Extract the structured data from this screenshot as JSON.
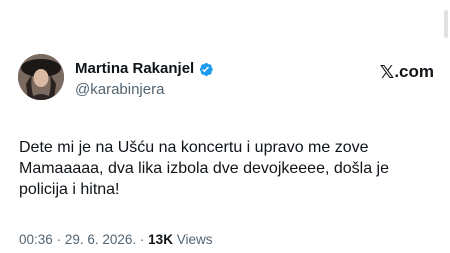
{
  "tweet": {
    "display_name": "Martina Rakanjel",
    "handle": "@karabinjera",
    "verified": true,
    "brand": {
      "glyph": "𝕏",
      "suffix": ".com"
    },
    "text": "Dete mi je na Ušću na koncertu i upravo me zove Mamaaaaa, dva lika izbola dve devojkeeee, došla je policija i hitna!",
    "time": "00:36",
    "separator": "·",
    "date": "29. 6. 2026.",
    "views_count": "13K",
    "views_label": "Views"
  },
  "colors": {
    "text": "#0f1419",
    "secondary": "#536471",
    "verified_blue": "#1d9bf0",
    "background": "#ffffff"
  },
  "icons": {
    "verified": "verified-badge-icon",
    "brand": "x-logo-icon"
  }
}
